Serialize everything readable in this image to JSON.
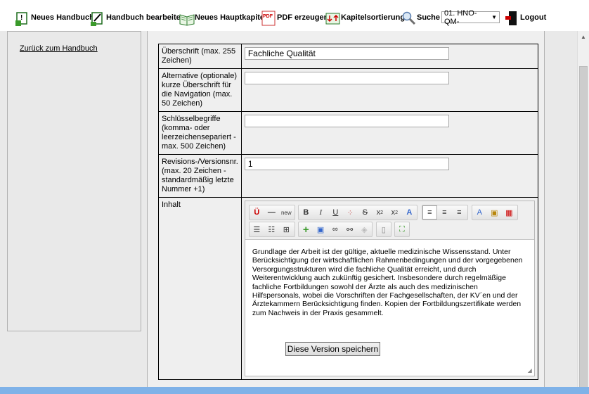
{
  "toolbar": {
    "new_manual": "Neues Handbuch",
    "edit_manual": "Handbuch bearbeiten",
    "new_chapter": "Neues Hauptkapitel",
    "pdf_icon_text": "PDF",
    "pdf": "PDF erzeugen",
    "sort": "Kapitelsortierung",
    "search": "Suche",
    "select_value": "01. HNO-QM-",
    "logout": "Logout"
  },
  "sidebar": {
    "back_link": "Zurück zum Handbuch"
  },
  "form": {
    "heading_label": "Überschrift (max. 255 Zeichen)",
    "heading_value": "Fachliche Qualität",
    "alt_label": "Alternative (optionale) kurze Überschrift für die Navigation (max. 50 Zeichen)",
    "alt_value": "",
    "keywords_label": "Schlüsselbegriffe (komma- oder leerzeichensepariert - max. 500 Zeichen)",
    "keywords_value": "",
    "revision_label": "Revisions-/Versionsnr. (max. 20 Zeichen - standardmäßig letzte Nummer +1)",
    "revision_value": "1",
    "content_label": "Inhalt"
  },
  "editor": {
    "row1": [
      "Ü",
      "—",
      "new",
      "B",
      "I",
      "U",
      "⁘",
      "S",
      "x₂",
      "x²",
      "A",
      "≡",
      "≡",
      "≡",
      "A",
      "📋",
      "📅"
    ],
    "body": "Grundlage der Arbeit ist der gültige, aktuelle medizinische Wissensstand.  Unter Berücksichtigung der wirtschaftlichen Rahmenbedingungen und der vorgegebenen Versorgungsstrukturen wird die fachliche Qualität erreicht, und durch Weiterentwicklung auch zukünftig gesichert. Insbesondere durch regelmäßige fachliche Fortbildungen sowohl der Ärzte als auch des medizinischen Hilfspersonals, wobei die Vorschriften der Fachgesellschaften, der KV´en und der Ärztekammern Berücksichtigung finden. Kopien der Fortbildungszertifikate werden zum Nachweis in der Praxis gesammelt."
  },
  "save_button": "Diese Version speichern",
  "colors": {
    "accent_green": "#3a9a2a",
    "window_bar": "#7fb2e8",
    "panel": "#e9e9e9"
  }
}
